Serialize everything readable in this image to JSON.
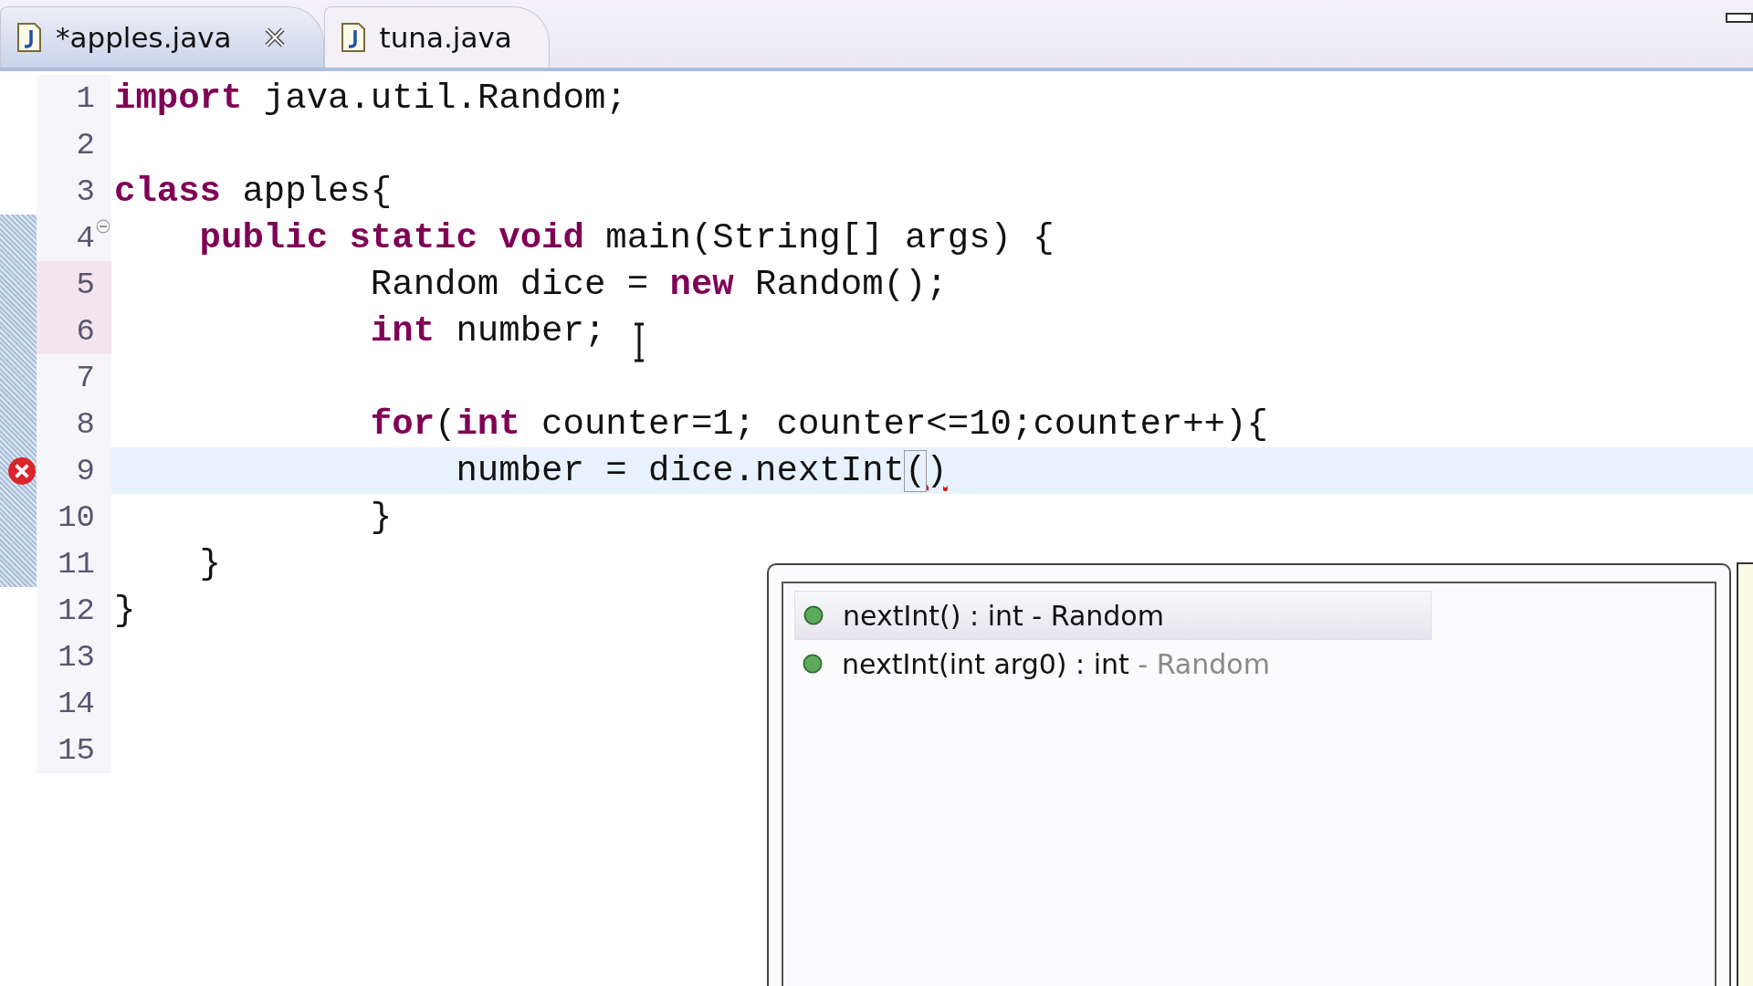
{
  "tabs": [
    {
      "label": "*apples.java",
      "selected": true
    },
    {
      "label": "tuna.java",
      "selected": false
    }
  ],
  "lines": [
    {
      "number": "1",
      "changed": false,
      "in_range": false,
      "current": false,
      "error": false,
      "foldable": false,
      "tokens": [
        {
          "text": "import",
          "kind": "keyword"
        },
        {
          "text": " java.util.Random;",
          "kind": "plain"
        }
      ]
    },
    {
      "number": "2",
      "changed": false,
      "in_range": false,
      "current": false,
      "error": false,
      "foldable": false
    },
    {
      "number": "3",
      "changed": false,
      "in_range": false,
      "current": false,
      "error": false,
      "foldable": false,
      "tokens": [
        {
          "text": "class",
          "kind": "keyword"
        },
        {
          "text": " apples{",
          "kind": "plain"
        }
      ]
    },
    {
      "number": "4",
      "changed": false,
      "in_range": true,
      "current": false,
      "error": false,
      "foldable": true,
      "tokens": [
        {
          "text": "    public static void",
          "kind": "keyword"
        },
        {
          "text": " main(String[] args) {",
          "kind": "plain"
        }
      ]
    },
    {
      "number": "5",
      "changed": true,
      "in_range": true,
      "current": false,
      "error": false,
      "foldable": false,
      "tokens": [
        {
          "text": "            Random dice = ",
          "kind": "plain"
        },
        {
          "text": "new",
          "kind": "keyword"
        },
        {
          "text": " Random();",
          "kind": "plain"
        }
      ]
    },
    {
      "number": "6",
      "changed": true,
      "in_range": true,
      "current": false,
      "error": false,
      "foldable": false,
      "tokens": [
        {
          "text": "            int",
          "kind": "keyword"
        },
        {
          "text": " number;",
          "kind": "plain"
        }
      ]
    },
    {
      "number": "7",
      "changed": false,
      "in_range": true,
      "current": false,
      "error": false,
      "foldable": false
    },
    {
      "number": "8",
      "changed": false,
      "in_range": true,
      "current": false,
      "error": false,
      "foldable": false,
      "tokens": [
        {
          "text": "            for",
          "kind": "keyword"
        },
        {
          "text": "(",
          "kind": "plain"
        },
        {
          "text": "int",
          "kind": "keyword"
        },
        {
          "text": " counter=1; counter<=10;counter++){",
          "kind": "plain"
        }
      ]
    },
    {
      "number": "9",
      "changed": false,
      "in_range": true,
      "current": true,
      "error": true,
      "foldable": false,
      "tokens": [
        {
          "text": "                number = dice.nextInt",
          "kind": "plain"
        },
        {
          "text": "(",
          "kind": "bracket"
        },
        {
          "text": ")",
          "kind": "error"
        }
      ]
    },
    {
      "number": "10",
      "changed": false,
      "in_range": true,
      "current": false,
      "error": false,
      "foldable": false,
      "tokens": [
        {
          "text": "            }",
          "kind": "plain"
        }
      ]
    },
    {
      "number": "11",
      "changed": false,
      "in_range": true,
      "current": false,
      "error": false,
      "foldable": false,
      "tokens": [
        {
          "text": "    }",
          "kind": "plain"
        }
      ]
    },
    {
      "number": "12",
      "changed": false,
      "in_range": false,
      "current": false,
      "error": false,
      "foldable": false,
      "tokens": [
        {
          "text": "}",
          "kind": "plain"
        }
      ]
    },
    {
      "number": "13",
      "changed": false,
      "in_range": false,
      "current": false,
      "error": false,
      "foldable": false
    },
    {
      "number": "14",
      "changed": false,
      "in_range": false,
      "current": false,
      "error": false,
      "foldable": false
    },
    {
      "number": "15",
      "changed": false,
      "in_range": false,
      "current": false,
      "error": false,
      "foldable": false
    }
  ],
  "completions": [
    {
      "label": "nextInt() : int",
      "qualifier": "- Random",
      "selected": true
    },
    {
      "label": "nextInt(int arg0) : int",
      "qualifier": "- Random",
      "selected": false
    }
  ]
}
